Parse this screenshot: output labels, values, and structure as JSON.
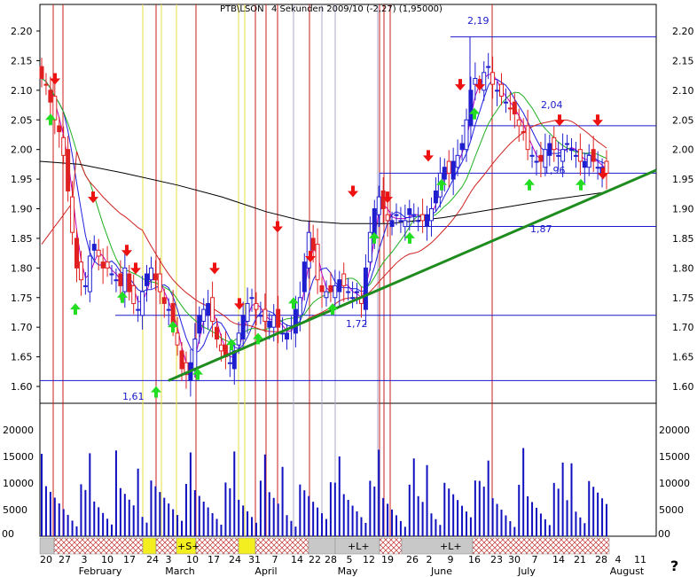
{
  "chart_data": {
    "type": "candlestick",
    "title": "PTB\\LSON",
    "title_overlay": "4 Sekunden 2009/10 (-2,27) (1,95000)",
    "price_axis": {
      "ylim": [
        1.57,
        2.25
      ],
      "ticks": [
        "1.60",
        "1.65",
        "1.70",
        "1.75",
        "1.80",
        "1.85",
        "1.90",
        "1.95",
        "2.00",
        "2.05",
        "2.10",
        "2.15",
        "2.20"
      ]
    },
    "volume_axis": {
      "ylim": [
        0,
        25000
      ],
      "ticks": [
        "5000",
        "10000",
        "15000",
        "20000"
      ]
    },
    "date_labels": [
      "20",
      "27",
      "3",
      "10",
      "17",
      "24",
      "3",
      "10",
      "17",
      "24",
      "31",
      "7",
      "14",
      "22",
      "28",
      "5",
      "12",
      "19",
      "26",
      "2",
      "9",
      "16",
      "23",
      "30",
      "7",
      "14",
      "21",
      "28",
      "4",
      "11"
    ],
    "month_labels": [
      "February",
      "March",
      "April",
      "May",
      "June",
      "July",
      "August"
    ],
    "levels": [
      {
        "label": "2,19",
        "value": 2.19
      },
      {
        "label": "2,04",
        "value": 2.04
      },
      {
        "label": "1,96",
        "value": 1.96
      },
      {
        "label": "1,87",
        "value": 1.87
      },
      {
        "label": "1,72",
        "value": 1.72
      },
      {
        "label": "1,61",
        "value": 1.61
      }
    ],
    "band_labels": [
      "+S+",
      "+L+",
      "+L+"
    ],
    "help_glyph": "?",
    "corner_label": "00",
    "colors": {
      "up_candle": "#1f1fd0",
      "down_candle": "#e02020",
      "ma_fast": "#c000c0",
      "ma_blue": "#2020e0",
      "ma_green": "#20b020",
      "ma_red": "#d02020",
      "ma_long": "#000000",
      "trend": "#1e8c1e",
      "buy_arrow": "#22dd22",
      "sell_arrow": "#ee1111",
      "volume": "#1010c0",
      "level_line": "#1a1acc"
    }
  }
}
